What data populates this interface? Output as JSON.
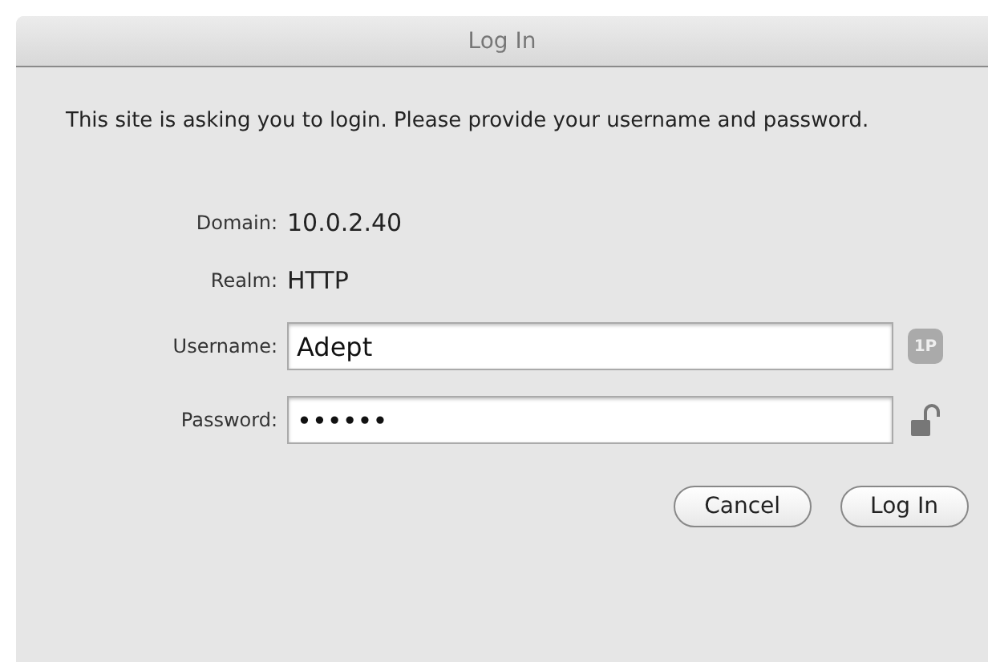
{
  "window": {
    "title": "Log In"
  },
  "message": "This site is asking you to login. Please provide your username and password.",
  "info": [
    {
      "label": "Domain:",
      "value": "10.0.2.40"
    },
    {
      "label": "Realm:",
      "value": "HTTP"
    }
  ],
  "fields": [
    {
      "label": "Username:",
      "value": "Adept",
      "kind": "badge",
      "badge": "1P"
    },
    {
      "label": "Password:",
      "value": "••••••",
      "kind": "lock"
    }
  ],
  "buttons": [
    "Cancel",
    "Log In"
  ]
}
